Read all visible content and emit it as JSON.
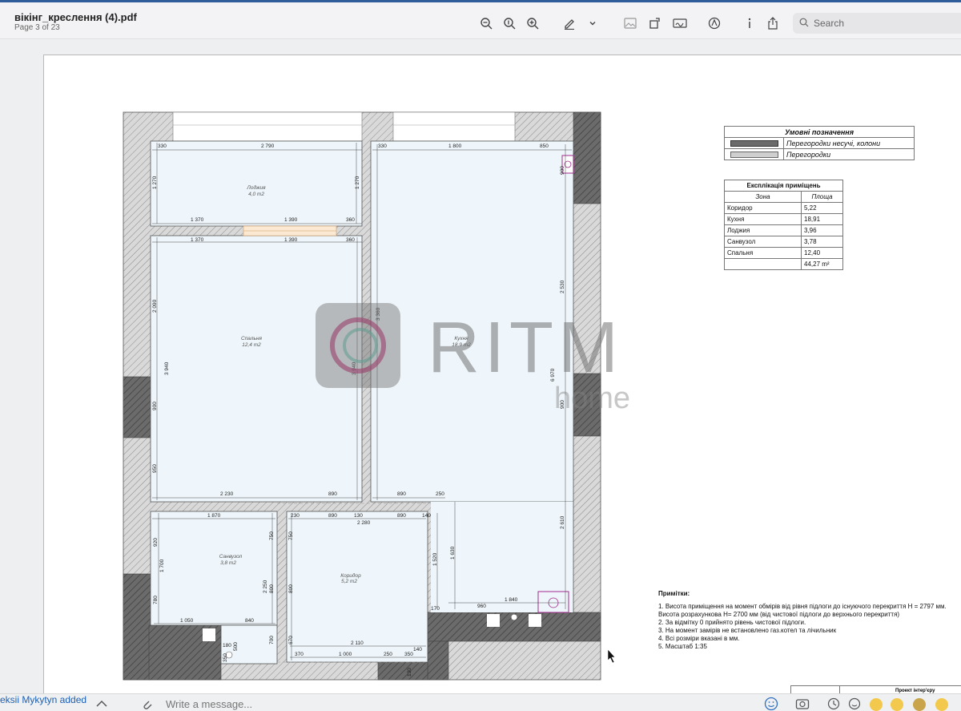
{
  "document": {
    "title": "вікінг_креслення (4).pdf",
    "page_info": "Page 3 of 23"
  },
  "toolbar": {
    "search_placeholder": "Search",
    "icons": [
      "zoom-out-icon",
      "actual-size-icon",
      "zoom-in-icon",
      "pen-icon",
      "chevron-down-icon",
      "image-icon",
      "rotate-icon",
      "signature-icon",
      "markup-icon",
      "info-icon",
      "share-icon",
      "search-icon"
    ]
  },
  "legend": {
    "title": "Умовні позначення",
    "items": [
      "Перегородки несучі, колони",
      "Перегородки"
    ]
  },
  "explication": {
    "title": "Експлікація приміщень",
    "col_zone": "Зона",
    "col_area": "Площа",
    "rows": [
      {
        "zone": "Коридор",
        "area": "5,22"
      },
      {
        "zone": "Кухня",
        "area": "18,91"
      },
      {
        "zone": "Лоджия",
        "area": "3,96"
      },
      {
        "zone": "Санвузол",
        "area": "3,78"
      },
      {
        "zone": "Спальня",
        "area": "12,40"
      }
    ],
    "total": "44,27 m²"
  },
  "rooms": {
    "loggia": {
      "name": "Лоджия",
      "area": "4,0 m2"
    },
    "bedroom": {
      "name": "Спальня",
      "area": "12,4 m2"
    },
    "kitchen": {
      "name": "Кухня",
      "area": "18,9 m2"
    },
    "bathroom": {
      "name": "Санвузол",
      "area": "3,8 m2"
    },
    "corridor": {
      "name": "Коридор",
      "area": "5,2 m2"
    }
  },
  "dimensions": {
    "d330a": "330",
    "d2790": "2 790",
    "d330b": "330",
    "d1800": "1 800",
    "d850": "850",
    "d1370a": "1 370",
    "d1390a": "1 390",
    "d360a": "360",
    "d1370b": "1 370",
    "d1390b": "1 390",
    "d360b": "360",
    "d1270a": "1 270",
    "d1270b": "1 270",
    "d2090": "2 090",
    "d3940": "3 940",
    "d900a": "900",
    "d950": "950",
    "d2230": "2 230",
    "d890a": "890",
    "d890b": "890",
    "d250": "250",
    "d2530": "2 530",
    "d6970": "6 970",
    "d900b": "900",
    "d2610": "2 610",
    "d900c": "900",
    "d1870": "1 870",
    "d230": "230",
    "d890c": "890",
    "d130": "130",
    "d890d": "890",
    "d140a": "140",
    "d2280": "2 280",
    "d920": "920",
    "d1700": "1 700",
    "d780": "780",
    "d750a": "750",
    "d750b": "750",
    "d2250": "2 250",
    "d800a": "800",
    "d800b": "800",
    "d1520": "1 520",
    "d1630": "1 630",
    "d1050": "1 050",
    "d840": "840",
    "d180": "180",
    "d500": "500",
    "d350a": "350",
    "d700": "700",
    "d670": "670",
    "d2110": "2 110",
    "d140b": "140",
    "d370": "370",
    "d1000": "1 000",
    "d250b": "250",
    "d350b": "350",
    "d130b": "130",
    "d960": "960",
    "d1840": "1 840",
    "d170": "170",
    "d3360": "3 360",
    "d3940b": "3 940"
  },
  "watermark": {
    "brand": "RITM",
    "sub": "home"
  },
  "notes": {
    "heading": "Примітки:",
    "lines": [
      "1. Висота приміщення на момент обмірів від рівня підлоги до існуючого перекриття H = 2797 мм.",
      "Висота розрахункова H= 2700 мм (від чистової підлоги до верхнього перекриття)",
      "2. За відмітку 0 прийнято рівень чистової підлоги.",
      "3. На момент замірів не встановлено газ.котел та лічильник",
      "4. Всі розміри вказані в мм.",
      "5. Масштаб 1:35"
    ]
  },
  "stamp": {
    "label": "Проект інтер'єру"
  },
  "chat": {
    "notification": "eksii Mykytyn added",
    "placeholder": "Write a message..."
  },
  "colors": {
    "room_fill": "#eef6fb",
    "wall_dark": "#6b6b6b",
    "wall_light": "#cfcfcf",
    "accent": "#2f5d9a"
  }
}
